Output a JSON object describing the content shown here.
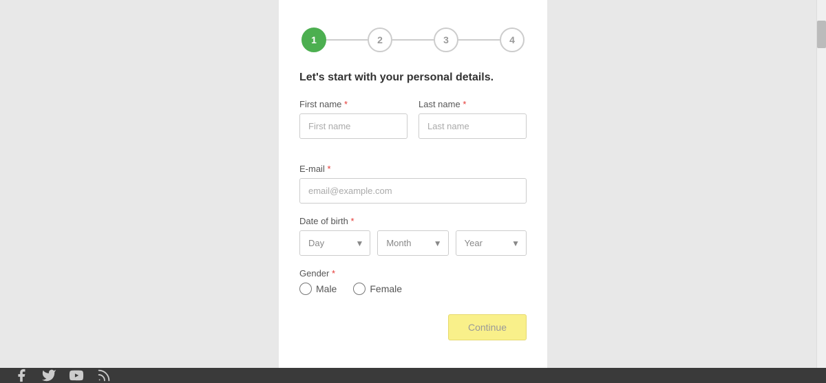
{
  "heading": "Let's start with your personal details.",
  "stepper": {
    "steps": [
      {
        "number": "1",
        "active": true
      },
      {
        "number": "2",
        "active": false
      },
      {
        "number": "3",
        "active": false
      },
      {
        "number": "4",
        "active": false
      }
    ]
  },
  "fields": {
    "first_name_label": "First name",
    "first_name_placeholder": "First name",
    "last_name_label": "Last name",
    "last_name_placeholder": "Last name",
    "email_label": "E-mail",
    "email_placeholder": "email@example.com",
    "dob_label": "Date of birth",
    "day_placeholder": "Day",
    "month_placeholder": "Month",
    "year_placeholder": "Year",
    "gender_label": "Gender",
    "male_label": "Male",
    "female_label": "Female"
  },
  "buttons": {
    "continue_label": "Continue"
  },
  "footer": {
    "facebook_icon": "f",
    "twitter_icon": "t",
    "youtube_icon": "y",
    "rss_icon": "r"
  }
}
